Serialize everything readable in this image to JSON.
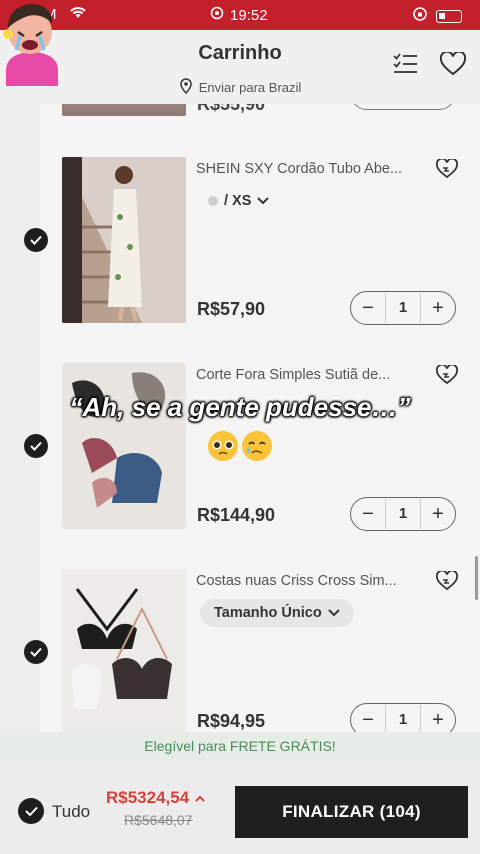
{
  "status_bar": {
    "carrier": "M",
    "time": "19:52"
  },
  "header": {
    "title": "Carrinho",
    "ship_to": "Enviar para Brazil"
  },
  "peek_item": {
    "price": "R$55,90"
  },
  "items": [
    {
      "name": "SHEIN SXY Cordão Tubo Abe...",
      "variant": "/ XS",
      "price": "R$57,90",
      "quantity": "1",
      "checked": true
    },
    {
      "name": "Corte Fora Simples Sutiã de...",
      "variant": "",
      "price": "R$144,90",
      "quantity": "1",
      "checked": true
    },
    {
      "name": "Costas nuas Criss Cross Sim...",
      "variant": "Tamanho Único",
      "price": "R$94,95",
      "quantity": "1",
      "checked": true
    }
  ],
  "free_shipping": "Elegível para FRETE GRÁTIS!",
  "bottom_bar": {
    "select_all_label": "Tudo",
    "total": "R$5324,54",
    "original_total": "R$5648,07",
    "checkout_label": "FINALIZAR (104)"
  },
  "overlay": {
    "caption": "“Ah, se a gente pudesse…”"
  },
  "colors": {
    "status_bar": "#c4202b",
    "total_price": "#d8403c",
    "checkout_button": "#1f1f1f",
    "free_shipping_text": "#4a8a5a"
  }
}
